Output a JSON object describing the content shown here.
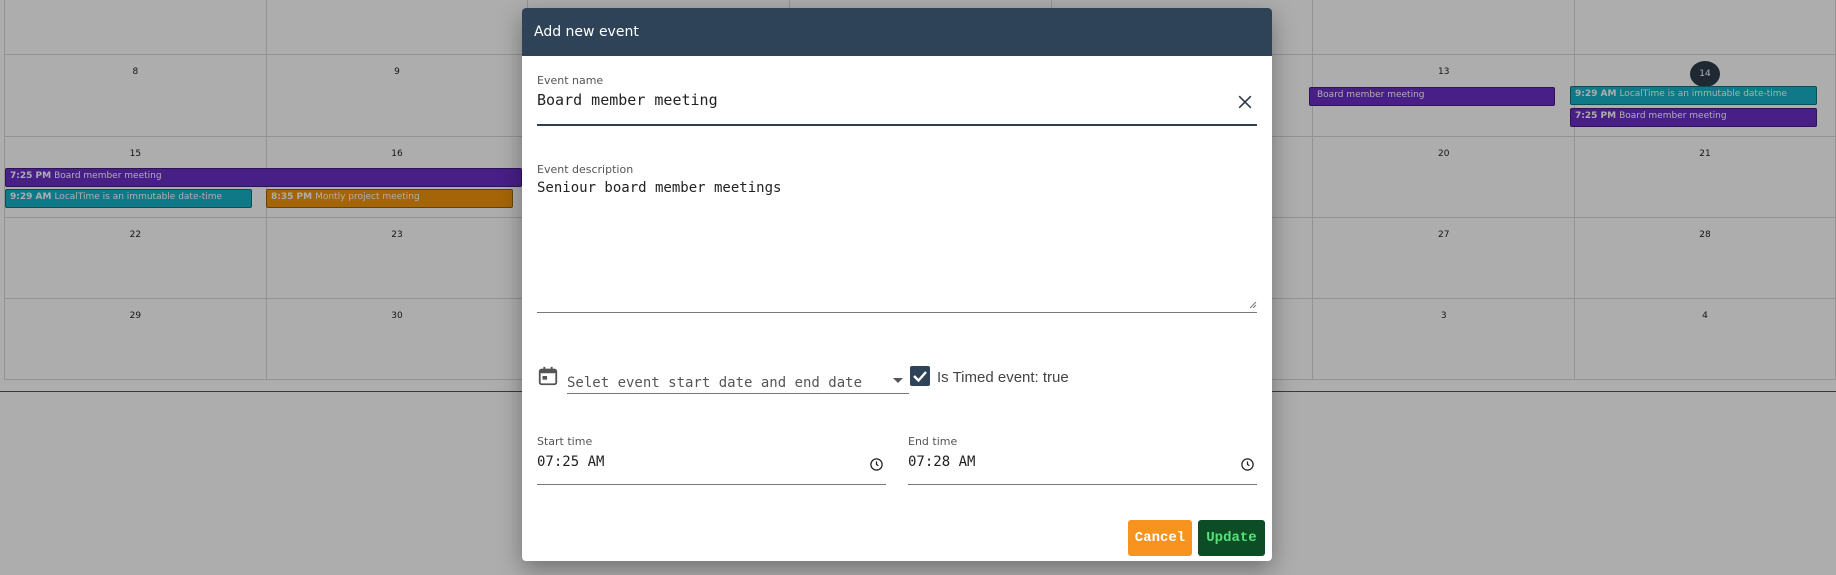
{
  "calendar": {
    "rows": [
      {
        "days": [
          "",
          "",
          "",
          "",
          "",
          "",
          ""
        ]
      },
      {
        "days": [
          "8",
          "9",
          "",
          "",
          "",
          "13",
          "14"
        ]
      },
      {
        "days": [
          "15",
          "16",
          "",
          "",
          "",
          "20",
          "21"
        ]
      },
      {
        "days": [
          "22",
          "23",
          "",
          "",
          "",
          "27",
          "28"
        ]
      },
      {
        "days": [
          "29",
          "30",
          "",
          "",
          "",
          "3",
          "4"
        ]
      }
    ],
    "events": [
      {
        "time": "",
        "title": "Board member meeting"
      },
      {
        "time": "9:29 AM",
        "title": "LocalTime is an immutable date-time"
      },
      {
        "time": "7:25 PM",
        "title": "Board member meeting"
      },
      {
        "time": "7:25 PM",
        "title": "Board member meeting"
      },
      {
        "time": "9:29 AM",
        "title": "LocalTime is an immutable date-time"
      },
      {
        "time": "8:35 PM",
        "title": "Montly project meeting"
      }
    ],
    "colors": {
      "purple": "#6a2fc7",
      "teal": "#17b3c9",
      "orange": "#f2960c",
      "today": "#2f3d4d"
    }
  },
  "dialog": {
    "title": "Add new event",
    "event_name": {
      "label": "Event name",
      "value": "Board member meeting"
    },
    "event_description": {
      "label": "Event description",
      "value": "Seniour board member meetings"
    },
    "date_select": {
      "placeholder": "Selet event start date and end date",
      "icon": "calendar-icon"
    },
    "timed_checkbox": {
      "label": "Is Timed event: true",
      "checked": true
    },
    "start_time": {
      "label": "Start time",
      "value": "07:25 AM"
    },
    "end_time": {
      "label": "End time",
      "value": "07:28 AM"
    },
    "buttons": {
      "cancel": "Cancel",
      "update": "Update"
    },
    "colors": {
      "header": "#2f4358",
      "cancel": "#f7931e",
      "update": "#0d4d25"
    }
  }
}
